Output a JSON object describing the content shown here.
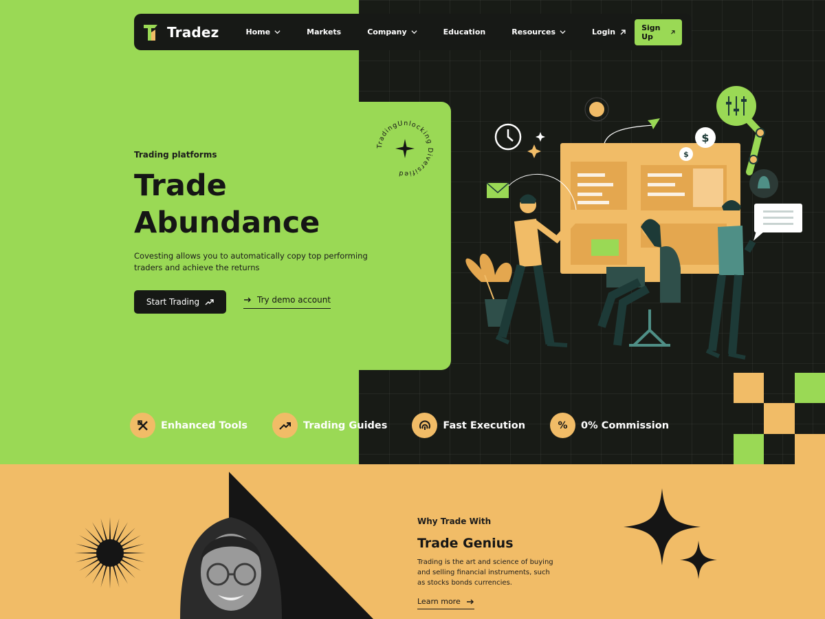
{
  "navbar": {
    "brand": "Tradez",
    "links": [
      {
        "label": "Home",
        "has_dropdown": true
      },
      {
        "label": "Markets",
        "has_dropdown": false
      },
      {
        "label": "Company",
        "has_dropdown": true
      },
      {
        "label": "Education",
        "has_dropdown": false
      },
      {
        "label": "Resources",
        "has_dropdown": true
      }
    ],
    "login_label": "Login",
    "signup_label": "Sign Up"
  },
  "hero": {
    "eyebrow": "Trading platforms",
    "title_line1": "Trade",
    "title_line2": "Abundance",
    "description": "Covesting allows you to automatically copy top performing traders and achieve the returns",
    "primary_cta": "Start Trading",
    "secondary_cta": "Try demo account",
    "badge_text": "TradingUnlocking Diversified"
  },
  "features": [
    {
      "label": "Enhanced Tools",
      "icon": "tools-icon"
    },
    {
      "label": "Trading Guides",
      "icon": "trend-up-icon"
    },
    {
      "label": "Fast Execution",
      "icon": "fingerprint-icon"
    },
    {
      "label": "0% Commission",
      "icon": "percent-icon",
      "icon_text": "%"
    }
  ],
  "why": {
    "eyebrow": "Why Trade With",
    "title": "Trade Genius",
    "description": "Trading is the art and science of buying and selling financial instruments, such as stocks bonds currencies.",
    "link_label": "Learn more"
  },
  "colors": {
    "green": "#9ad955",
    "dark": "#181b16",
    "orange": "#f1bc67",
    "text": "#151515"
  }
}
